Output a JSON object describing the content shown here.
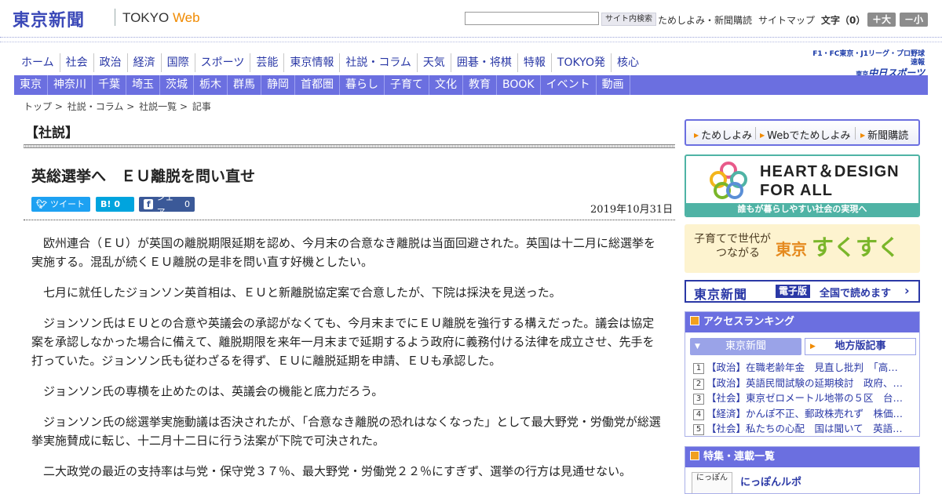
{
  "header": {
    "logo_jp": "東京新聞",
    "logo_en_prefix": "TOKYO ",
    "logo_en_suffix": "Web",
    "search_placeholder": "",
    "search_button": "サイト内検索",
    "trial_link": "ためしよみ・新聞購読",
    "sitemap_link": "サイトマップ",
    "fontsize_label": "文字（0）",
    "font_up": "＋大",
    "font_down": "－小"
  },
  "global_nav": [
    "ホーム",
    "社会",
    "政治",
    "経済",
    "国際",
    "スポーツ",
    "芸能",
    "東京情報",
    "社説・コラム",
    "天気",
    "囲碁・将棋",
    "特報",
    "TOKYO発",
    "核心"
  ],
  "sports_banner": {
    "top": "F1・FC東京・J1リーグ・プロ野球速報",
    "bottom_small": "東京",
    "bottom": "中日スポーツ"
  },
  "regional_nav": [
    "東京",
    "神奈川",
    "千葉",
    "埼玉",
    "茨城",
    "栃木",
    "群馬",
    "静岡",
    "首都圏",
    "暮らし",
    "子育て",
    "文化",
    "教育",
    "BOOK",
    "イベント",
    "動画"
  ],
  "breadcrumb": [
    "トップ",
    "社説・コラム",
    "社説一覧",
    "記事"
  ],
  "breadcrumb_sep": ">",
  "section_title": "【社説】",
  "article": {
    "title": "英総選挙へ　ＥＵ離脱を問い直せ",
    "date": "2019年10月31日",
    "share": {
      "tweet": "ツイート",
      "hatena_count": "0",
      "fb_label": "シェア",
      "fb_count": "0"
    },
    "paragraphs": [
      "欧州連合（ＥＵ）が英国の離脱期限延期を認め、今月末の合意なき離脱は当面回避された。英国は十二月に総選挙を実施する。混乱が続くＥＵ離脱の是非を問い直す好機としたい。",
      "七月に就任したジョンソン英首相は、ＥＵと新離脱協定案で合意したが、下院は採決を見送った。",
      "ジョンソン氏はＥＵとの合意や英議会の承認がなくても、今月末までにＥＵ離脱を強行する構えだった。議会は協定案を承認しなかった場合に備えて、離脱期限を来年一月末まで延期するよう政府に義務付ける法律を成立させ、先手を打っていた。ジョンソン氏も従わざるを得ず、ＥＵに離脱延期を申請、ＥＵも承認した。",
      "ジョンソン氏の専横を止めたのは、英議会の機能と底力だろう。",
      "ジョンソン氏の総選挙実施動議は否決されたが、「合意なき離脱の恐れはなくなった」として最大野党・労働党が総選挙実施賛成に転じ、十二月十二日に行う法案が下院で可決された。",
      "二大政党の最近の支持率は与党・保守党３７％、最大野党・労働党２２％にすぎず、選挙の行方は見通せない。"
    ]
  },
  "sidebar": {
    "subscribe": [
      "ためしよみ",
      "Webでためしよみ",
      "新聞購読"
    ],
    "heart_line1": "HEART＆DESIGN",
    "heart_line2": "FOR ALL",
    "heart_foot": "誰もが暮らしやすい社会の実現へ",
    "suku_line1": "子育てで世代が",
    "suku_line2": "つながる",
    "suku_tokyo": "東京",
    "suku_word": "すくすく",
    "ebook_logo": "東京新聞",
    "ebook_tag": "電子版",
    "ebook_text": "全国で読めます",
    "ranking_title": "アクセスランキング",
    "ranking_tabs": [
      "東京新聞",
      "地方版記事"
    ],
    "ranking": [
      {
        "no": "1",
        "text": "【政治】在職老齢年金　見直し批判　「高…"
      },
      {
        "no": "2",
        "text": "【政治】英語民間試験の延期検討　政府、…"
      },
      {
        "no": "3",
        "text": "【社会】東京ゼロメートル地帯の５区　台…"
      },
      {
        "no": "4",
        "text": "【経済】かんぽ不正、郵政株売れず　株価…"
      },
      {
        "no": "5",
        "text": "【社会】私たちの心配　国は聞いて　英語…"
      }
    ],
    "feature_title": "特集・連載一覧",
    "nippon_thumb": "にっぽん",
    "nippon_title": "にっぽんルポ"
  },
  "colors": {
    "brand_blue": "#3b49b8",
    "nav_purple": "#6b6fe0",
    "accent_orange": "#f08a00",
    "twitter": "#1da1f2",
    "hatena": "#00a4de",
    "facebook": "#3b5998"
  }
}
